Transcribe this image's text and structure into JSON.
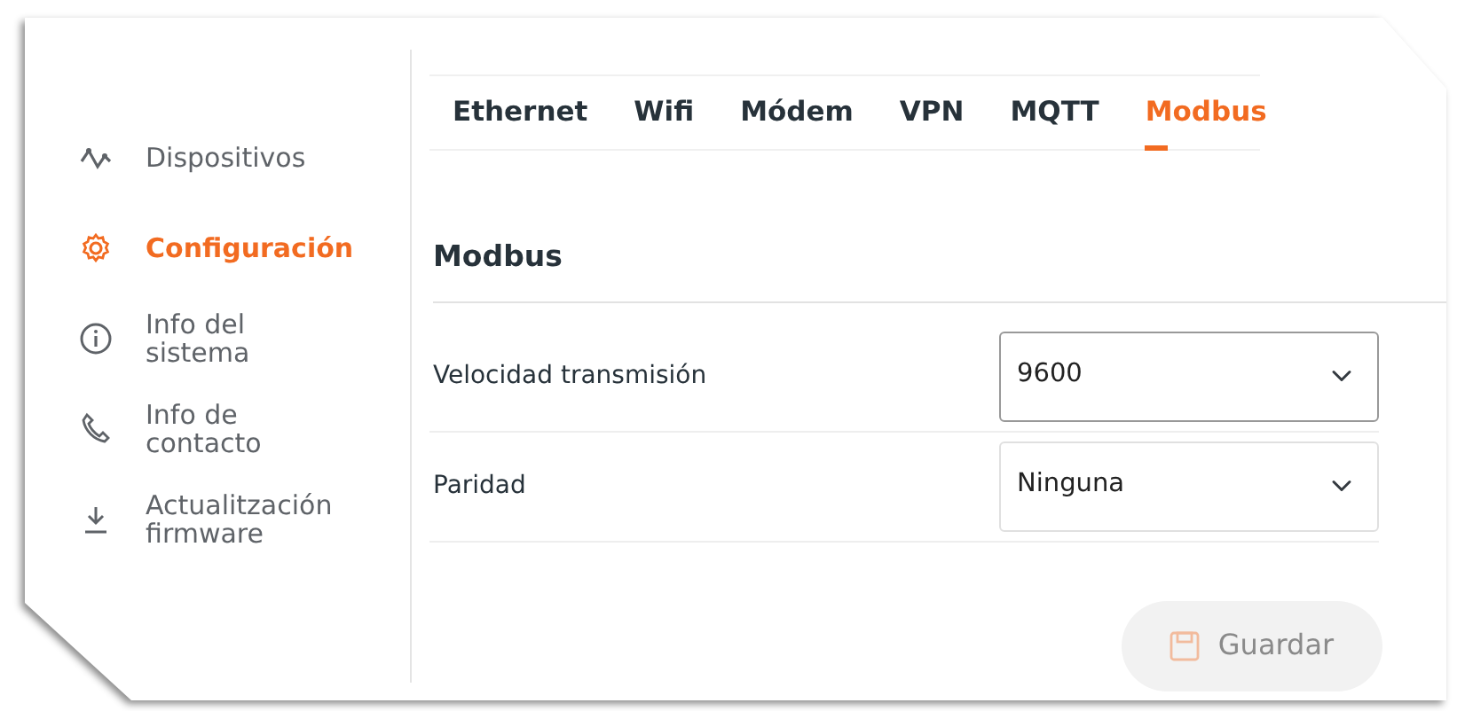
{
  "sidebar": {
    "items": [
      {
        "label": "Dispositivos",
        "selected": false
      },
      {
        "label": "Configuración",
        "selected": true
      },
      {
        "label": "Info del sistema",
        "selected": false
      },
      {
        "label": "Info de contacto",
        "selected": false
      },
      {
        "label": "Actualitzación firmware",
        "selected": false
      }
    ]
  },
  "tabs": [
    {
      "label": "Ethernet",
      "selected": false
    },
    {
      "label": "Wifi",
      "selected": false
    },
    {
      "label": "Módem",
      "selected": false
    },
    {
      "label": "VPN",
      "selected": false
    },
    {
      "label": "MQTT",
      "selected": false
    },
    {
      "label": "Modbus",
      "selected": true
    }
  ],
  "section": {
    "title": "Modbus"
  },
  "fields": [
    {
      "label": "Velocidad transmisión",
      "value": "9600",
      "focused": true
    },
    {
      "label": "Paridad",
      "value": "Ninguna",
      "focused": false
    }
  ],
  "save_button": {
    "label": "Guardar",
    "disabled": true
  }
}
